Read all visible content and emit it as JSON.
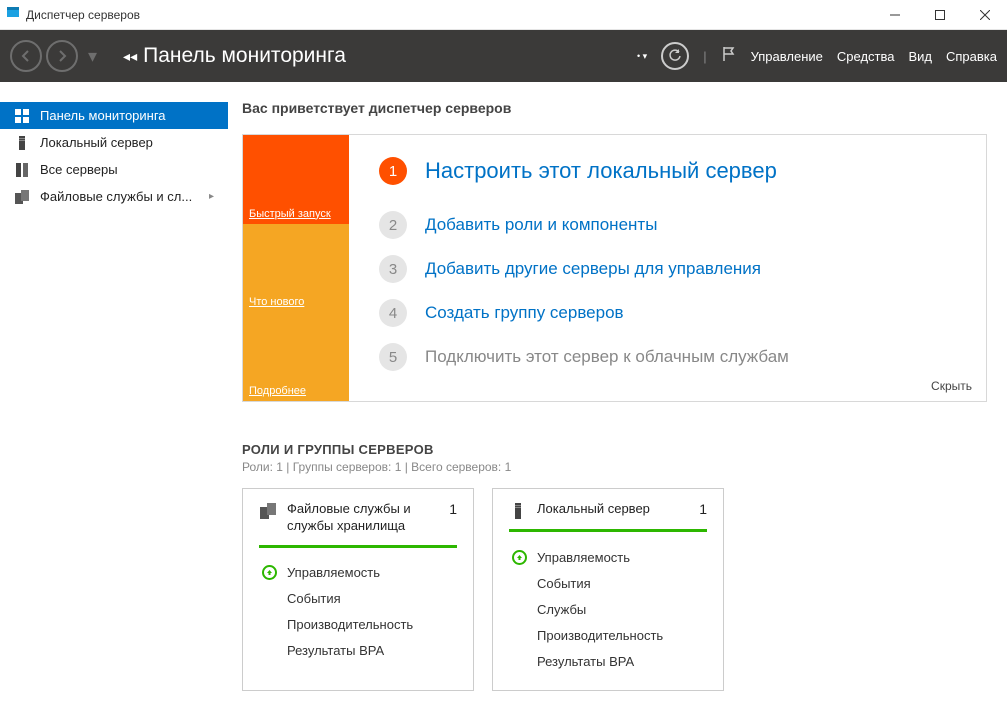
{
  "window": {
    "title": "Диспетчер серверов"
  },
  "header": {
    "breadcrumb_prefix": "◂◂",
    "page_title": "Панель мониторинга",
    "menu": [
      "Управление",
      "Средства",
      "Вид",
      "Справка"
    ]
  },
  "sidebar": {
    "items": [
      {
        "label": "Панель мониторинга"
      },
      {
        "label": "Локальный сервер"
      },
      {
        "label": "Все серверы"
      },
      {
        "label": "Файловые службы и сл..."
      }
    ]
  },
  "welcome": "Вас приветствует диспетчер серверов",
  "quickstart": {
    "tabs": [
      "Быстрый запуск",
      "Что нового",
      "Подробнее"
    ],
    "steps": [
      {
        "n": "1",
        "label": "Настроить этот локальный сервер",
        "primary": true
      },
      {
        "n": "2",
        "label": "Добавить роли и компоненты"
      },
      {
        "n": "3",
        "label": "Добавить другие серверы для управления"
      },
      {
        "n": "4",
        "label": "Создать группу серверов"
      },
      {
        "n": "5",
        "label": "Подключить этот сервер к облачным службам",
        "disabled": true
      }
    ],
    "hide": "Скрыть"
  },
  "roles": {
    "title": "РОЛИ И ГРУППЫ СЕРВЕРОВ",
    "sub": "Роли: 1 | Группы серверов: 1 | Всего серверов: 1",
    "tiles": [
      {
        "title": "Файловые службы и службы хранилища",
        "count": "1",
        "rows": [
          "Управляемость",
          "События",
          "Производительность",
          "Результаты BPA"
        ]
      },
      {
        "title": "Локальный сервер",
        "count": "1",
        "rows": [
          "Управляемость",
          "События",
          "Службы",
          "Производительность",
          "Результаты BPA"
        ]
      }
    ]
  }
}
